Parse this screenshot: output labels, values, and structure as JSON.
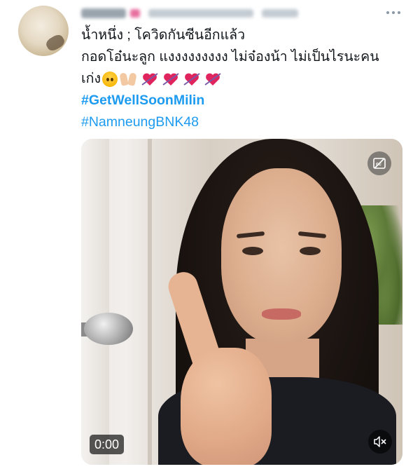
{
  "tweet": {
    "author_display_name_blurred": true,
    "text_lines": [
      "น้ำหนึ่ง ; โควิดกันซีนอีกแล้ว",
      "กอดโอ๋นะลูก แงงงงงงงงง ไม่จ๋องน้า ไม่เป็นไรนะคน",
      "เก่ง"
    ],
    "hashtags": [
      "#GetWellSoonMilin",
      "#NamneungBNK48"
    ],
    "emojis": [
      "pleading-face-icon",
      "palms-up-together-icon",
      "heart-with-arrow-icon",
      "heart-with-arrow-icon",
      "heart-with-arrow-icon",
      "heart-with-arrow-icon"
    ]
  },
  "video": {
    "time": "0:00",
    "captions_icon": "captions-off-icon",
    "volume_icon": "muted-speaker-icon"
  },
  "colors": {
    "hashtag": "#1d9bf0",
    "text": "#0f1419",
    "heart": "#e0245e"
  }
}
